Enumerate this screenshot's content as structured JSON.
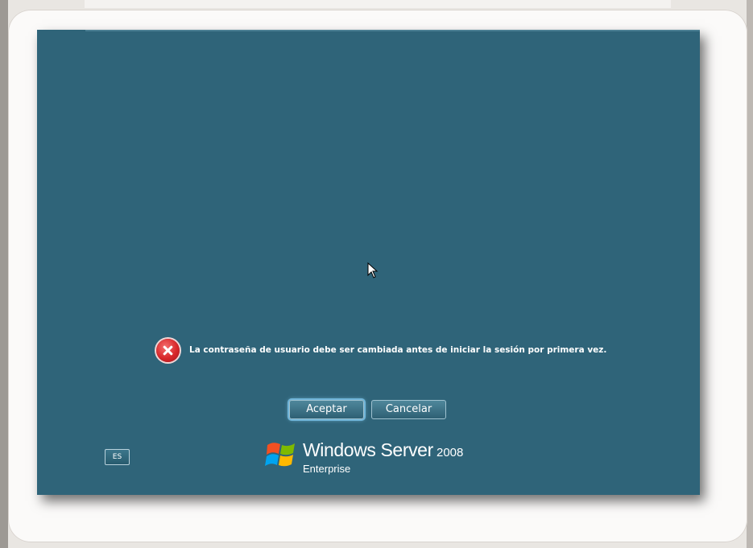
{
  "dialog": {
    "message": "La contraseña de usuario debe ser cambiada antes de iniciar la sesión por primera vez.",
    "ok_label": "Aceptar",
    "cancel_label": "Cancelar",
    "icon": "error-icon"
  },
  "language_indicator": "ES",
  "branding": {
    "product": "Windows Server",
    "year": "2008",
    "edition": "Enterprise",
    "logo_icon": "windows-flag-icon"
  },
  "colors": {
    "background": "#2f6479",
    "error": "#d8272a",
    "button_focus_glow": "#6fb4d8"
  }
}
